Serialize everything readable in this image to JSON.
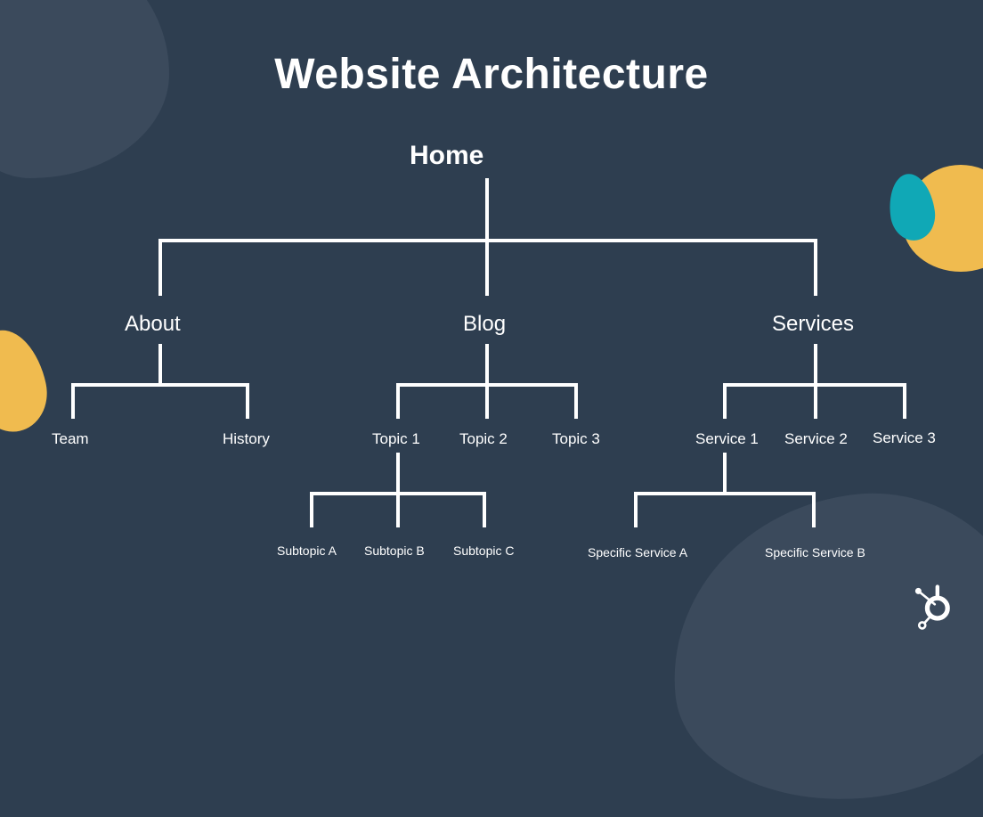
{
  "title": "Website Architecture",
  "tree": {
    "root": "Home",
    "level2": {
      "about": "About",
      "blog": "Blog",
      "services": "Services"
    },
    "about_children": {
      "team": "Team",
      "history": "History"
    },
    "blog_children": {
      "topic1": "Topic 1",
      "topic2": "Topic 2",
      "topic3": "Topic 3"
    },
    "services_children": {
      "service1": "Service 1",
      "service2": "Service 2",
      "service3": "Service 3"
    },
    "topic1_children": {
      "subA": "Subtopic A",
      "subB": "Subtopic B",
      "subC": "Subtopic C"
    },
    "service1_children": {
      "specA": "Specific Service A",
      "specB": "Specific Service B"
    }
  },
  "colors": {
    "background": "#2e3e50",
    "blobDark": "#3b4a5c",
    "accentYellow": "#f0bb4f",
    "accentTeal": "#10a8b6",
    "text": "#ffffff"
  },
  "brand": {
    "logo_name": "hubspot-sprocket"
  }
}
